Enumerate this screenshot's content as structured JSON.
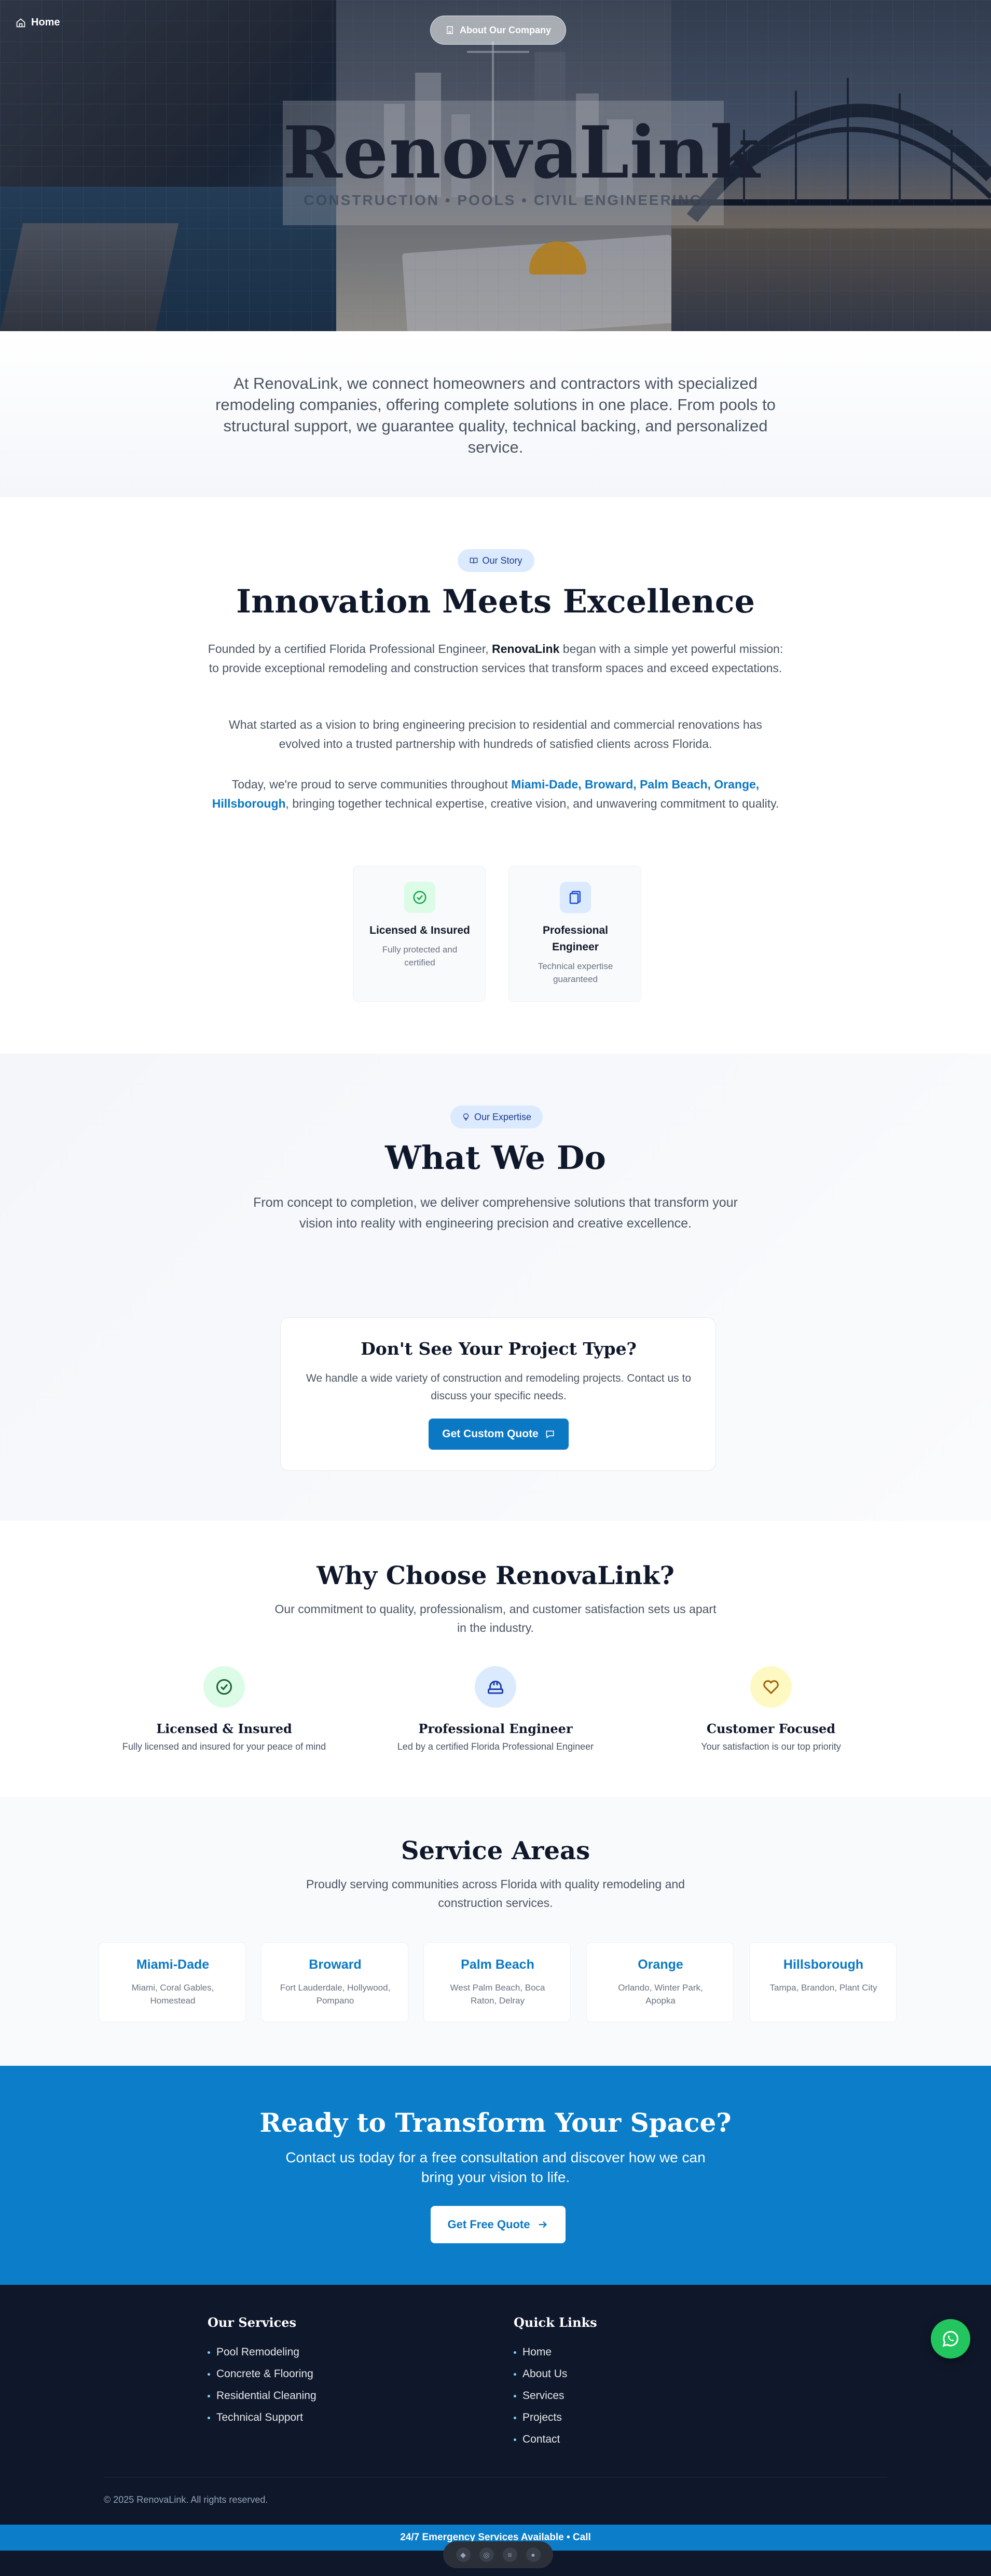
{
  "nav": {
    "home_label": "Home",
    "about_label": "About Our Company"
  },
  "hero": {
    "title": "RenovaLink",
    "subtitle": "CONSTRUCTION • POOLS • CIVIL ENGINEERING"
  },
  "intro": {
    "text": "At RenovaLink, we connect homeowners and contractors with specialized remodeling companies, offering complete solutions in one place. From pools to structural support, we guarantee quality, technical backing, and personalized service."
  },
  "story": {
    "badge": "Our Story",
    "title": "Innovation Meets Excellence",
    "p1_start": "Founded by a certified Florida Professional Engineer, ",
    "p1_brand": "RenovaLink",
    "p1_end": " began with a simple yet powerful mission: to provide exceptional remodeling and construction services that transform spaces and exceed expectations.",
    "p2": "What started as a vision to bring engineering precision to residential and commercial renovations has evolved into a trusted partnership with hundreds of satisfied clients across Florida.",
    "p3_start": "Today, we're proud to serve communities throughout ",
    "p3_areas": "Miami-Dade, Broward, Palm Beach, Orange, Hillsborough",
    "p3_end": ", bringing together technical expertise, creative vision, and unwavering commitment to quality.",
    "cards": [
      {
        "title": "Licensed & Insured",
        "desc": "Fully protected and certified"
      },
      {
        "title": "Professional Engineer",
        "desc": "Technical expertise guaranteed"
      }
    ]
  },
  "expertise": {
    "badge": "Our Expertise",
    "title": "What We Do",
    "desc": "From concept to completion, we deliver comprehensive solutions that transform your vision into reality with engineering precision and creative excellence.",
    "quote_card": {
      "title": "Don't See Your Project Type?",
      "desc": "We handle a wide variety of construction and remodeling projects. Contact us to discuss your specific needs.",
      "button": "Get Custom Quote"
    }
  },
  "why": {
    "title": "Why Choose RenovaLink?",
    "desc": "Our commitment to quality, professionalism, and customer satisfaction sets us apart in the industry.",
    "items": [
      {
        "title": "Licensed & Insured",
        "desc": "Fully licensed and insured for your peace of mind"
      },
      {
        "title": "Professional Engineer",
        "desc": "Led by a certified Florida Professional Engineer"
      },
      {
        "title": "Customer Focused",
        "desc": "Your satisfaction is our top priority"
      }
    ]
  },
  "areas": {
    "title": "Service Areas",
    "desc": "Proudly serving communities across Florida with quality remodeling and construction services.",
    "items": [
      {
        "name": "Miami-Dade",
        "cities": "Miami, Coral Gables, Homestead"
      },
      {
        "name": "Broward",
        "cities": "Fort Lauderdale, Hollywood, Pompano"
      },
      {
        "name": "Palm Beach",
        "cities": "West Palm Beach, Boca Raton, Delray"
      },
      {
        "name": "Orange",
        "cities": "Orlando, Winter Park, Apopka"
      },
      {
        "name": "Hillsborough",
        "cities": "Tampa, Brandon, Plant City"
      }
    ]
  },
  "cta": {
    "title": "Ready to Transform Your Space?",
    "desc": "Contact us today for a free consultation and discover how we can bring your vision to life.",
    "button": "Get Free Quote"
  },
  "footer": {
    "services_head": "Our Services",
    "services": [
      "Pool Remodeling",
      "Concrete & Flooring",
      "Residential Cleaning",
      "Technical Support"
    ],
    "links_head": "Quick Links",
    "links": [
      "Home",
      "About Us",
      "Services",
      "Projects",
      "Contact"
    ],
    "copyright": "© 2025 RenovaLink. All rights reserved.",
    "emergency": "24/7 Emergency Services Available • Call"
  },
  "colors": {
    "brand_blue": "#0b78c4",
    "dark_navy": "#0f172a",
    "whatsapp_green": "#22c55e"
  }
}
